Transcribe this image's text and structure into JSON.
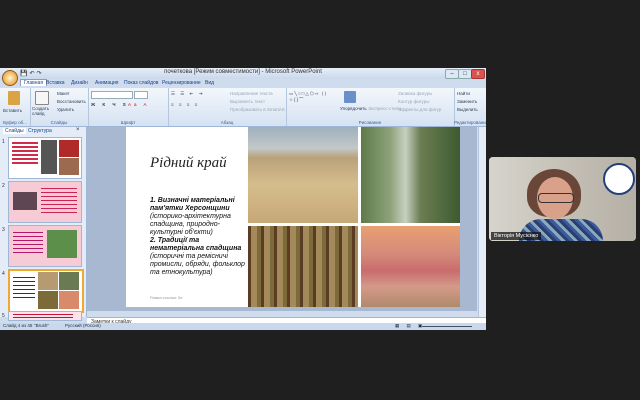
{
  "window": {
    "title": "почеткова [Режим совместимости] - Microsoft PowerPoint",
    "controls": {
      "minimize": "–",
      "maximize": "□",
      "close": "x"
    }
  },
  "ribbon": {
    "tabs": [
      "Главная",
      "Вставка",
      "Дизайн",
      "Анимация",
      "Показ слайдов",
      "Рецензирование",
      "Вид"
    ],
    "clipboard": {
      "paste": "Вставить",
      "label": "Буфер об..."
    },
    "slides": {
      "new_slide": "Создать слайд",
      "layout": "Макет",
      "reset": "Восстановить",
      "delete": "Удалить",
      "label": "Слайды"
    },
    "font": {
      "label": "Шрифт"
    },
    "paragraph": {
      "text_direction": "Направление текста",
      "align_text": "Выровнять текст",
      "smartart": "Преобразовать в SmartArt",
      "label": "Абзац"
    },
    "drawing": {
      "arrange": "Упорядочить",
      "quick_styles": "Экспресс-стили",
      "fill": "Заливка фигуры",
      "outline": "Контур фигуры",
      "effects": "Эффекты для фигур",
      "label": "Рисование"
    },
    "editing": {
      "find": "Найти",
      "replace": "Заменить",
      "select": "Выделить",
      "label": "Редактирование"
    }
  },
  "sidebar": {
    "tabs": [
      "Слайды",
      "Структура"
    ],
    "thumbs": [
      "1",
      "2",
      "3",
      "4",
      "5"
    ]
  },
  "slide": {
    "title": "Рідний край",
    "item1_title": "1. Визначні матеріальні пам'ятки Херсонщини",
    "item1_text": "(історико-архітектурна спадщина, природно-культурні об'єкти)",
    "item2_title": "2. Традиції та нематеріальна спадщина",
    "item2_text": "(історичні та ремісничі промисли, обряди, фольклор та етнокультура)",
    "footer": "Рамка ссылки: 5е"
  },
  "notes": {
    "placeholder": "Заметки к слайду"
  },
  "status": {
    "slide": "Слайд 4 из 45",
    "theme": "\"Brush\"",
    "language": "Русский (Россия)"
  },
  "video": {
    "participant": "Вікторія Мусієнко"
  }
}
